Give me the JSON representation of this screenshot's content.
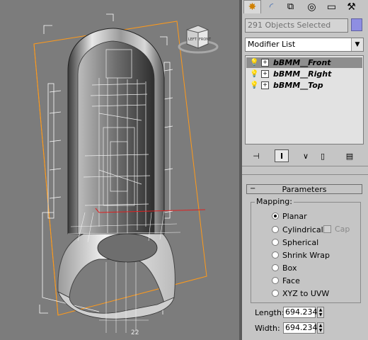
{
  "viewport": {
    "viewcube": {
      "left_label": "LEFT",
      "front_label": "FRONT"
    },
    "axis_label": "22"
  },
  "panel": {
    "tabs": [
      {
        "name": "create-tab",
        "icon": "star-icon",
        "glyph": "✸",
        "color": "#d08000",
        "active": true
      },
      {
        "name": "modify-tab",
        "icon": "modify-curve-icon",
        "glyph": "◜",
        "color": "#3a66b0",
        "active": false
      },
      {
        "name": "hierarchy-tab",
        "icon": "hierarchy-icon",
        "glyph": "⧉",
        "color": "#333333",
        "active": false
      },
      {
        "name": "motion-tab",
        "icon": "motion-icon",
        "glyph": "◎",
        "color": "#333333",
        "active": false
      },
      {
        "name": "display-tab",
        "icon": "display-icon",
        "glyph": "▭",
        "color": "#333333",
        "active": false
      },
      {
        "name": "utilities-tab",
        "icon": "hammer-icon",
        "glyph": "⚒",
        "color": "#333333",
        "active": false
      }
    ],
    "selection_count": "291 Objects Selected",
    "selection_color": "#8e8ee2",
    "modifier_list": "Modifier List",
    "stack": [
      {
        "label": "bBMM__Front",
        "selected": true
      },
      {
        "label": "bBMM__Right",
        "selected": false
      },
      {
        "label": "bBMM__Top",
        "selected": false
      }
    ],
    "stack_buttons": [
      {
        "name": "pin-stack-button",
        "icon": "pin-icon",
        "glyph": "⊣"
      },
      {
        "name": "show-end-result-button",
        "icon": "end-result-icon",
        "glyph": "I"
      },
      {
        "name": "make-unique-button",
        "icon": "make-unique-icon",
        "glyph": "∨"
      },
      {
        "name": "remove-modifier-button",
        "icon": "trash-icon",
        "glyph": "▯"
      },
      {
        "name": "configure-sets-button",
        "icon": "configure-icon",
        "glyph": "▤"
      }
    ],
    "parameters": {
      "title": "Parameters",
      "mapping_label": "Mapping:",
      "options": [
        "Planar",
        "Cylindrical",
        "Spherical",
        "Shrink Wrap",
        "Box",
        "Face",
        "XYZ to UVW"
      ],
      "selected": "Planar",
      "cap_label": "Cap",
      "length_label": "Length:",
      "length_value": "694.234",
      "width_label": "Width:",
      "width_value": "694.234"
    }
  }
}
